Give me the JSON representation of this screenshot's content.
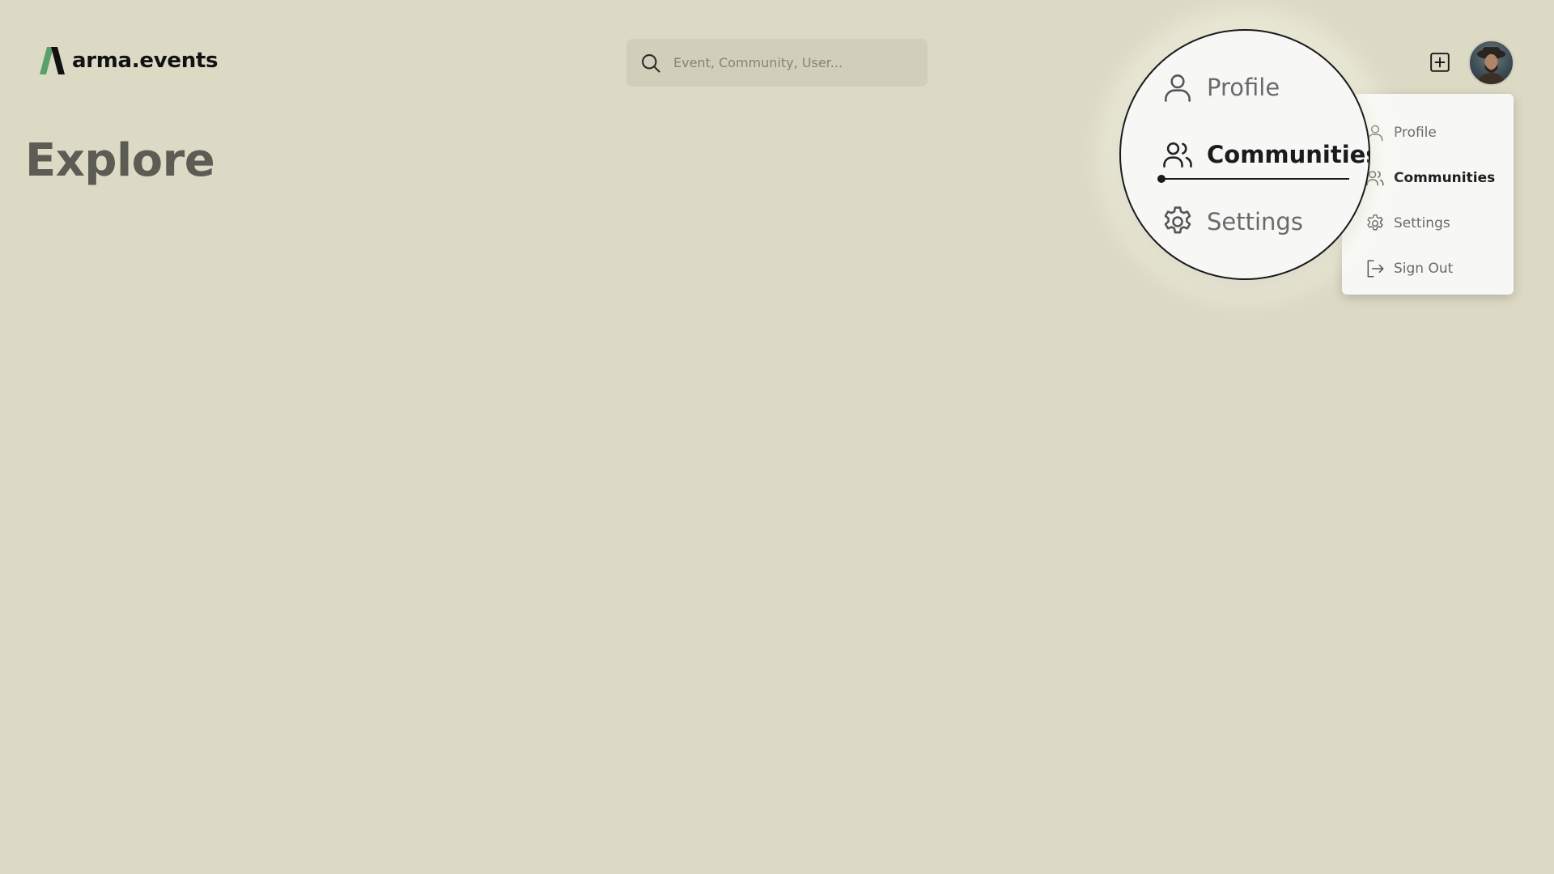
{
  "brand": {
    "name": "arma.events",
    "accent": "#5aa06a"
  },
  "search": {
    "placeholder": "Event, Community, User..."
  },
  "page": {
    "title": "Explore"
  },
  "header": {
    "add_icon": "plus-square-icon",
    "avatar_icon": "user-avatar"
  },
  "menu": {
    "items": [
      {
        "label": "Profile",
        "icon": "user-icon"
      },
      {
        "label": "Communities",
        "icon": "users-icon",
        "active": true
      },
      {
        "label": "Settings",
        "icon": "gear-icon"
      },
      {
        "label": "Sign Out",
        "icon": "sign-out-icon"
      }
    ]
  },
  "colors": {
    "background": "#dcdac4",
    "menu_bg": "#f7f7f6",
    "title": "#5c5c54"
  }
}
